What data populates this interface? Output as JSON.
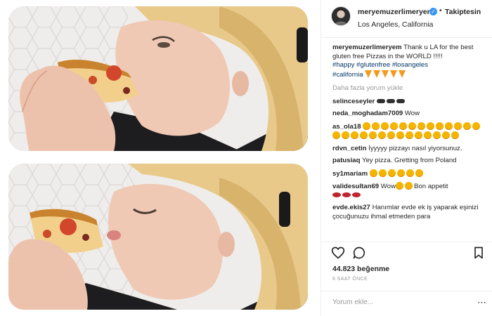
{
  "post": {
    "username": "meryemuzerlimeryem",
    "follow_dot": "•",
    "follow_label": "Takiptesin",
    "location": "Los Angeles, California",
    "verified_mark": "✓"
  },
  "caption": {
    "user": "meryemuzerlimeryem",
    "text": "Thank u LA for the best gluten free Pizzas in the WORLD !!!!!",
    "hashtags": [
      "#happy",
      "#glutenfree",
      "#losangeles",
      "#california"
    ]
  },
  "load_more": "Daha fazla yorum yükle",
  "comments": [
    {
      "user": "selinceseyler",
      "text": "",
      "emoji": "sunglasses",
      "emoji_count": 3
    },
    {
      "user": "neda_moghadam7009",
      "text": "Wow"
    },
    {
      "user": "as_ola18",
      "text": "",
      "emoji": "grin",
      "emoji_count": 27
    },
    {
      "user": "rdvn_cetin",
      "text": "İyyyyy pizzayı nasıl yiyorsunuz."
    },
    {
      "user": "patusiaq",
      "text": "Yey pizza. Gretting from Poland"
    },
    {
      "user": "sy1mariam",
      "text": "",
      "emoji": "grin",
      "emoji_count": 6
    },
    {
      "user": "validesultan69",
      "text_before": "Wow",
      "text_after": "Bon appetit",
      "emoji_mid": 2,
      "lips": 3
    },
    {
      "user": "evde.ekis27",
      "text": "Hanımlar evde ek iş yaparak eşinizi çocuğunuzu ihmal etmeden para"
    }
  ],
  "likes": "44.823 beğenme",
  "timestamp": "6 SAAT ÖNCE",
  "comment_placeholder": "Yorum ekle...",
  "more_dots": "⋯",
  "colors": {
    "link": "#003569",
    "verified": "#3897f0",
    "muted": "#999999"
  }
}
